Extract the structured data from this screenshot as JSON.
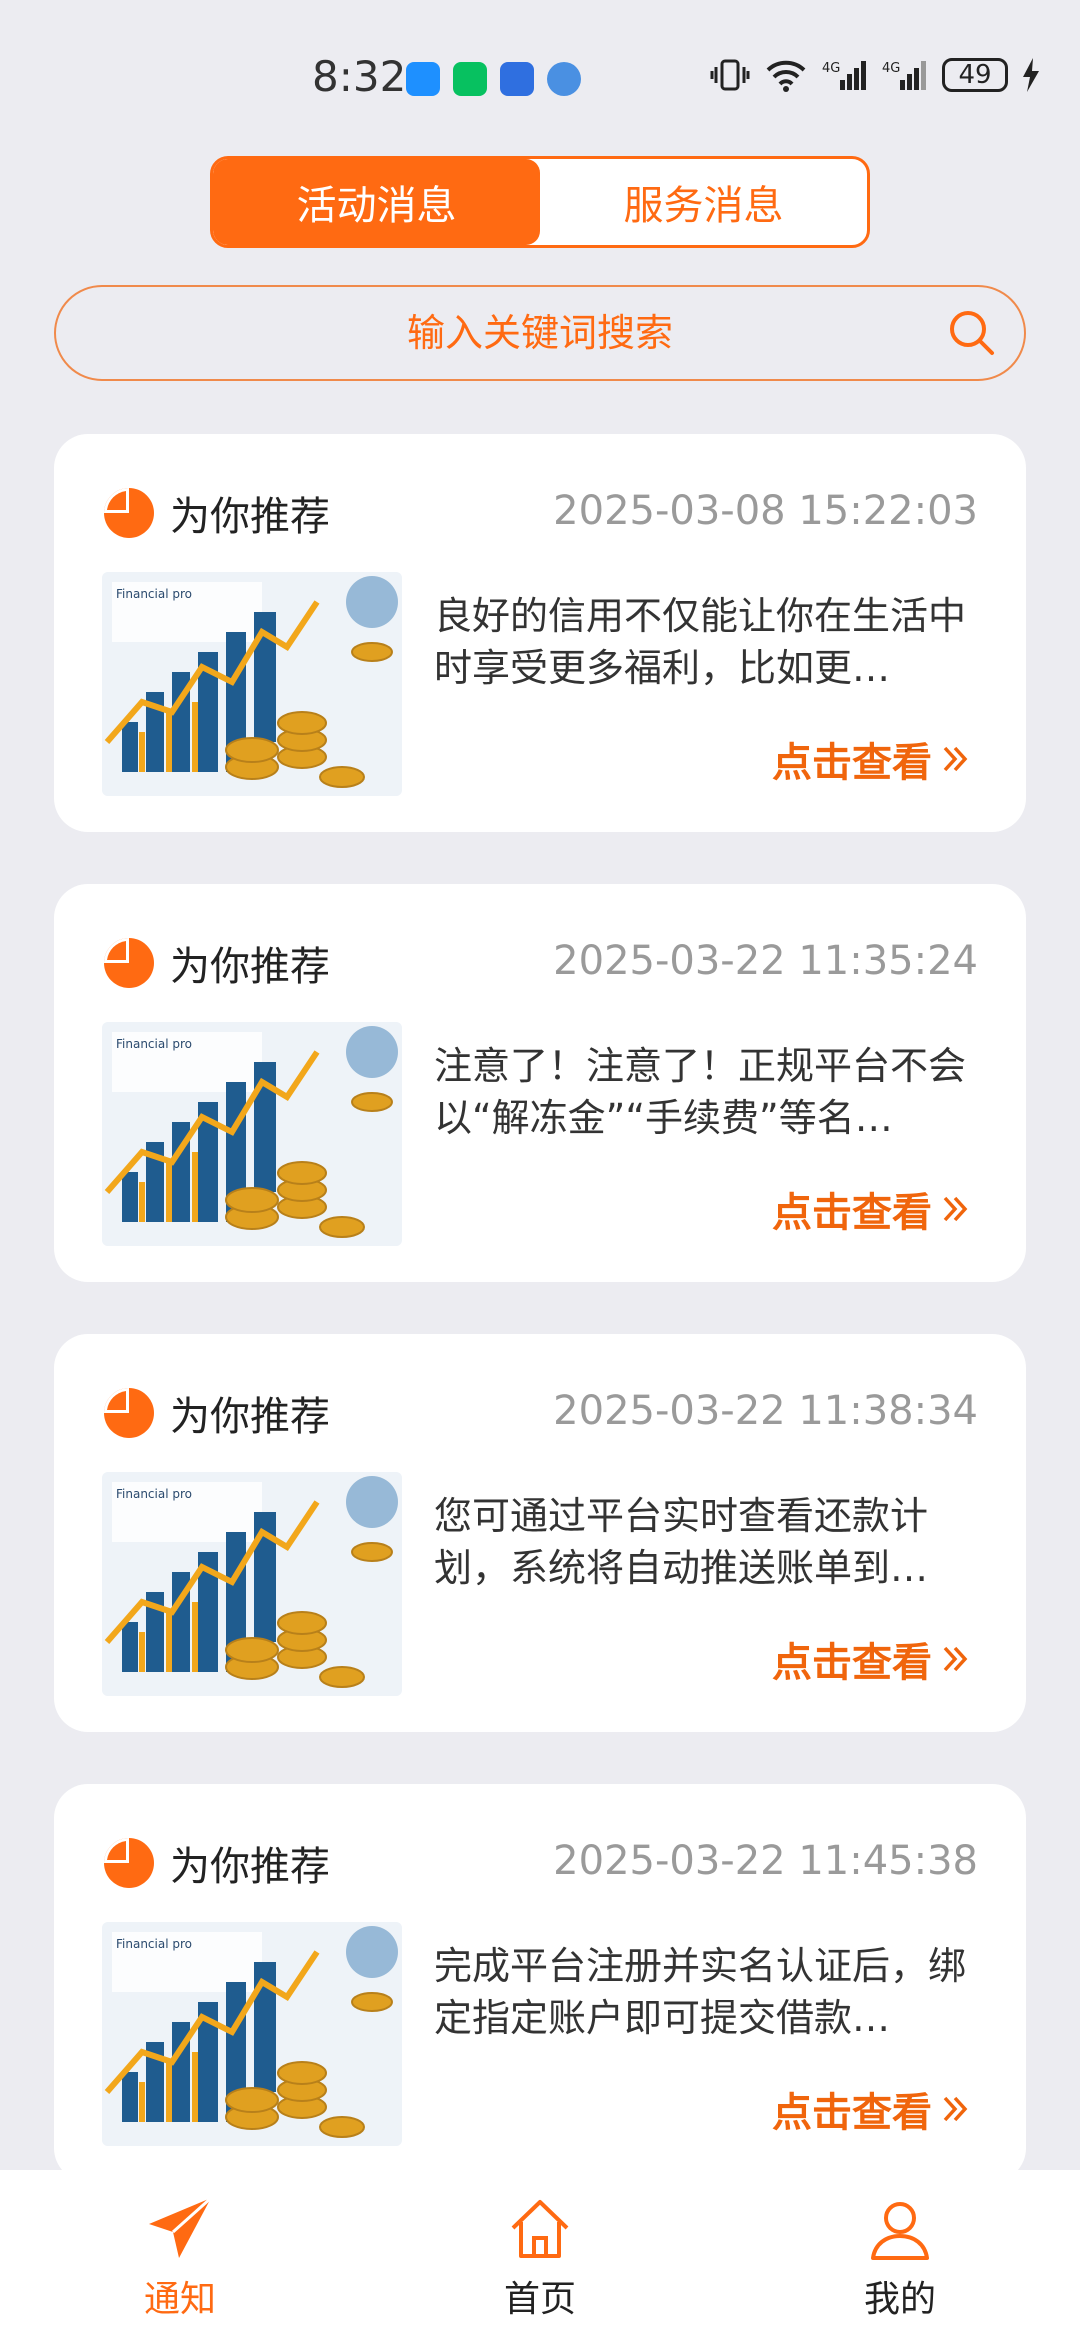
{
  "status": {
    "time": "8:32",
    "battery": "49"
  },
  "tabs": [
    {
      "label": "活动消息",
      "active": true
    },
    {
      "label": "服务消息",
      "active": false
    }
  ],
  "search": {
    "placeholder": "输入关键词搜索"
  },
  "messages": [
    {
      "category": "为你推荐",
      "time": "2025-03-08 15:22:03",
      "text": "良好的信用不仅能让你在生活中时享受更多福利，比如更…",
      "link": "点击查看"
    },
    {
      "category": "为你推荐",
      "time": "2025-03-22 11:35:24",
      "text": "注意了！注意了！正规平台不会以“解冻金”“手续费”等名…",
      "link": "点击查看"
    },
    {
      "category": "为你推荐",
      "time": "2025-03-22 11:38:34",
      "text": "您可通过平台实时查看还款计划，系统将自动推送账单到…",
      "link": "点击查看"
    },
    {
      "category": "为你推荐",
      "time": "2025-03-22 11:45:38",
      "text": "完成平台注册并实名认证后，绑定指定账户即可提交借款…",
      "link": "点击查看"
    }
  ],
  "nav": [
    {
      "label": "通知",
      "icon": "paper-plane-icon",
      "active": true
    },
    {
      "label": "首页",
      "icon": "home-icon",
      "active": false
    },
    {
      "label": "我的",
      "icon": "user-icon",
      "active": false
    }
  ],
  "colors": {
    "accent": "#FF6A12",
    "background": "#ECECF1"
  }
}
